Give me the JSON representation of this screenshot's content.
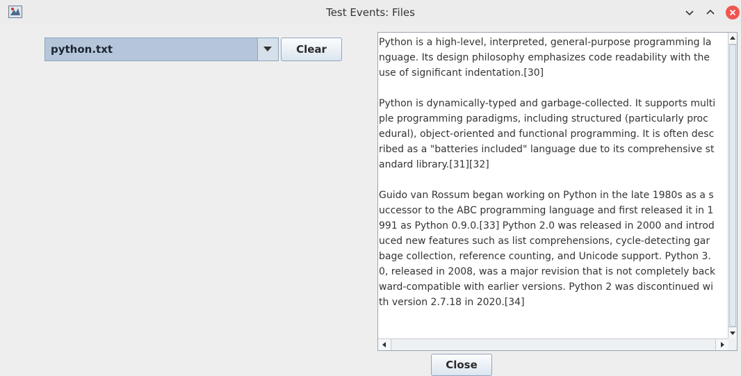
{
  "window": {
    "title": "Test Events: Files",
    "icon": "app-icon",
    "controls": [
      "chevron-down-icon",
      "chevron-up-icon",
      "close-icon"
    ],
    "close_color": "#f0554f"
  },
  "file_select": {
    "selected": "python.txt",
    "icon": "triangle-down-icon"
  },
  "buttons": {
    "clear": "Clear",
    "close": "Close"
  },
  "text_area": {
    "content": "Python is a high-level, interpreted, general-purpose programming la\nnguage. Its design philosophy emphasizes code readability with the\nuse of significant indentation.[30]\n\nPython is dynamically-typed and garbage-collected. It supports multi\nple programming paradigms, including structured (particularly proc\nedural), object-oriented and functional programming. It is often desc\nribed as a \"batteries included\" language due to its comprehensive st\nandard library.[31][32]\n\nGuido van Rossum began working on Python in the late 1980s as a s\nuccessor to the ABC programming language and first released it in 1\n991 as Python 0.9.0.[33] Python 2.0 was released in 2000 and introd\nuced new features such as list comprehensions, cycle-detecting gar\nbage collection, reference counting, and Unicode support. Python 3.\n0, released in 2008, was a major revision that is not completely back\nward-compatible with earlier versions. Python 2 was discontinued wi\nth version 2.7.18 in 2020.[34]"
  }
}
